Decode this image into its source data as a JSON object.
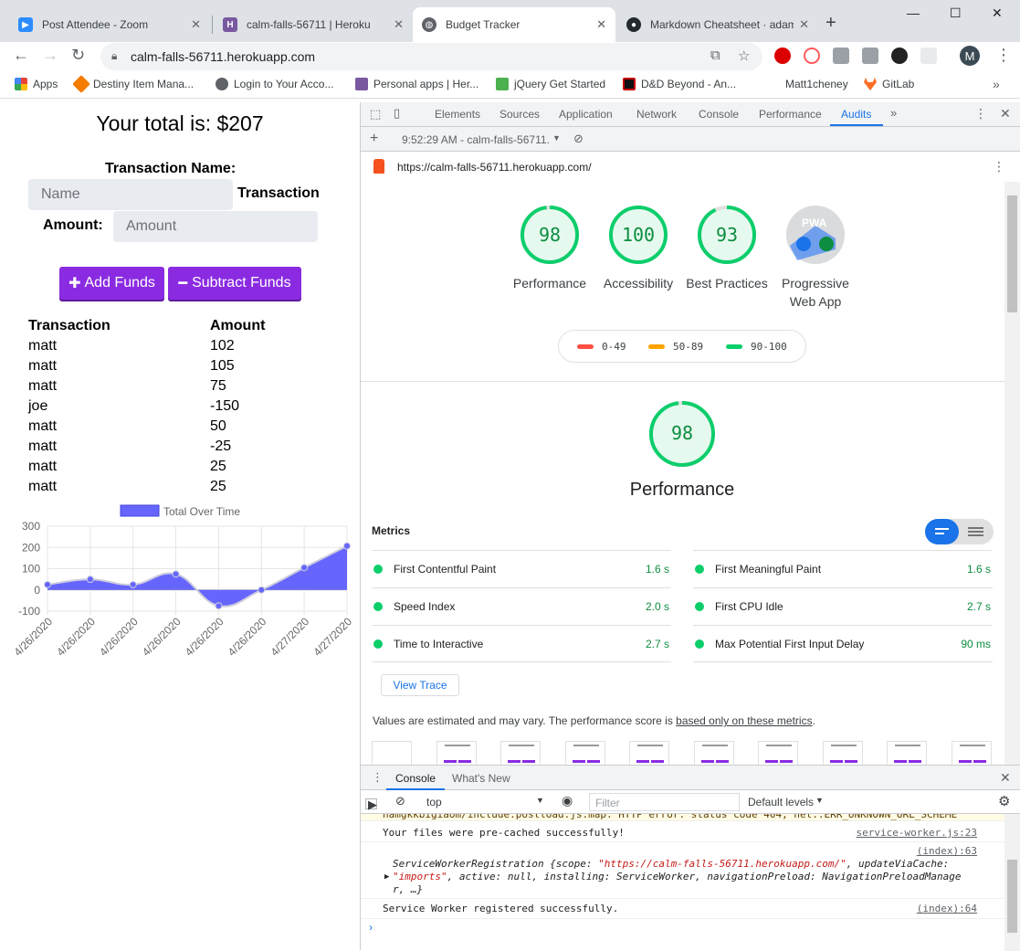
{
  "browser": {
    "tabs": [
      {
        "label": "Post Attendee - Zoom",
        "icon": "zoom-icon",
        "color": "#2d8cff"
      },
      {
        "label": "calm-falls-56711 | Heroku",
        "icon": "heroku-icon",
        "color": "#79589f"
      },
      {
        "label": "Budget Tracker",
        "icon": "globe-icon",
        "color": "#5f6368"
      },
      {
        "label": "Markdown Cheatsheet · adam",
        "icon": "github-icon",
        "color": "#24292e"
      }
    ],
    "url": "calm-falls-56711.herokuapp.com",
    "profile_initial": "M",
    "bookmarks": [
      {
        "label": "Apps",
        "icon": "apps-grid-icon",
        "color": "#ea4335"
      },
      {
        "label": "Destiny Item Mana...",
        "icon": "destiny-icon",
        "color": "#f57c00"
      },
      {
        "label": "Login to Your Acco...",
        "icon": "globe-icon",
        "color": "#5f6368"
      },
      {
        "label": "Personal apps | Her...",
        "icon": "heroku-icon",
        "color": "#79589f"
      },
      {
        "label": "jQuery Get Started",
        "icon": "w3-icon",
        "color": "#4caf50"
      },
      {
        "label": "D&D Beyond - An...",
        "icon": "dnd-icon",
        "color": "#c00"
      },
      {
        "label": "Matt1cheney",
        "icon": "",
        "color": ""
      },
      {
        "label": "GitLab",
        "icon": "gitlab-icon",
        "color": "#fc6d26"
      }
    ]
  },
  "app": {
    "total_text": "Your total is: $207",
    "name_label": "Transaction Name:",
    "name_placeholder": "Name",
    "amount_label_part1": "Transaction",
    "amount_label_part2": "Amount:",
    "amount_placeholder": "Amount",
    "add_button": "Add Funds",
    "subtract_button": "Subtract Funds",
    "table_headers": [
      "Transaction",
      "Amount"
    ],
    "transactions": [
      {
        "name": "matt",
        "amount": "102"
      },
      {
        "name": "matt",
        "amount": "105"
      },
      {
        "name": "matt",
        "amount": "75"
      },
      {
        "name": "joe",
        "amount": "-150"
      },
      {
        "name": "matt",
        "amount": "50"
      },
      {
        "name": "matt",
        "amount": "-25"
      },
      {
        "name": "matt",
        "amount": "25"
      },
      {
        "name": "matt",
        "amount": "25"
      }
    ]
  },
  "chart_data": {
    "type": "area",
    "legend": "Total Over Time",
    "x": [
      "4/26/2020",
      "4/26/2020",
      "4/26/2020",
      "4/26/2020",
      "4/26/2020",
      "4/26/2020",
      "4/27/2020",
      "4/27/2020"
    ],
    "values": [
      25,
      50,
      25,
      75,
      -75,
      0,
      105,
      207
    ],
    "yticks": [
      300,
      200,
      100,
      0,
      -100
    ],
    "ylim": [
      -100,
      300
    ],
    "color": "#6666ff"
  },
  "devtools": {
    "tabs": [
      "Elements",
      "Sources",
      "Application",
      "Network",
      "Console",
      "Performance",
      "Audits"
    ],
    "active_tab": "Audits",
    "session": "9:52:29 AM - calm-falls-56711.",
    "report_url": "https://calm-falls-56711.herokuapp.com/",
    "scores": [
      {
        "label": "Performance",
        "value": "98"
      },
      {
        "label": "Accessibility",
        "value": "100"
      },
      {
        "label": "Best Practices",
        "value": "93"
      },
      {
        "label": "Progressive Web App",
        "value": "PWA"
      }
    ],
    "legend": [
      "0-49",
      "50-89",
      "90-100"
    ],
    "perf_score": "98",
    "perf_title": "Performance",
    "metrics_title": "Metrics",
    "metrics": [
      {
        "name": "First Contentful Paint",
        "value": "1.6 s"
      },
      {
        "name": "First Meaningful Paint",
        "value": "1.6 s"
      },
      {
        "name": "Speed Index",
        "value": "2.0 s"
      },
      {
        "name": "First CPU Idle",
        "value": "2.7 s"
      },
      {
        "name": "Time to Interactive",
        "value": "2.7 s"
      },
      {
        "name": "Max Potential First Input Delay",
        "value": "90 ms"
      }
    ],
    "view_trace": "View Trace",
    "estimate_text": "Values are estimated and may vary. The performance score is ",
    "estimate_link": "based only on these metrics",
    "estimate_end": "."
  },
  "console": {
    "tabs": [
      "Console",
      "What's New"
    ],
    "context": "top",
    "filter_placeholder": "Filter",
    "levels": "Default levels",
    "cut_line": "namgkkbigiaom/include.postload.js.map: HTTP error: status code 404, net::ERR_UNKNOWN_URL_SCHEME",
    "msg1": "Your files were pre-cached successfully!",
    "msg1_src": "service-worker.js:23",
    "msg2_src": "(index):63",
    "msg2_a": "ServiceWorkerRegistration {scope: ",
    "msg2_scope": "\"https://calm-falls-56711.herokuapp.com/\"",
    "msg2_b": ", updateViaCache:",
    "msg2_imports": "\"imports\"",
    "msg2_c": ", active: null, installing: ServiceWorker, navigationPreload: NavigationPreloadManage",
    "msg2_d": "r, …}",
    "msg3": "Service Worker registered successfully.",
    "msg3_src": "(index):64"
  }
}
